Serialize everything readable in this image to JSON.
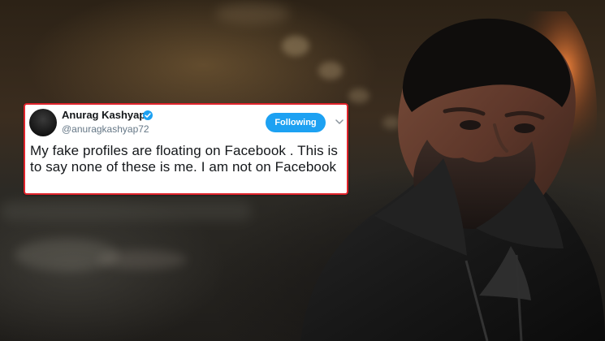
{
  "tweet": {
    "display_name": "Anurag Kashyap",
    "handle": "@anuragkashyap72",
    "follow_button_label": "Following",
    "text": "My fake profiles are floating on Facebook . This is to say none of these is me. I am not on Facebook",
    "avatar_icon": "avatar",
    "verified_icon": "verified-icon",
    "menu_icon": "chevron-down-icon",
    "highlight_color": "#e0232b",
    "accent_color": "#1da1f2"
  },
  "scene": {
    "background_type": "blurred photo"
  }
}
